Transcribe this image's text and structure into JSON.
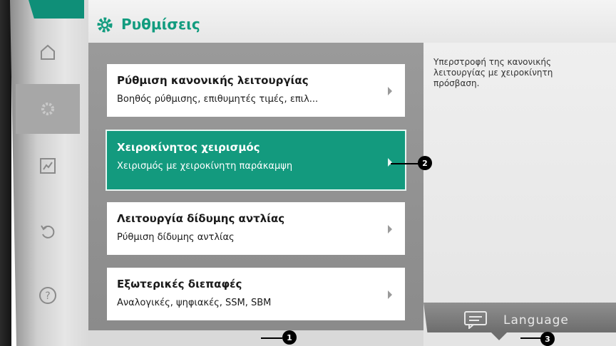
{
  "header": {
    "title": "Ρυθμίσεις",
    "icon": "gear-icon"
  },
  "sidebar": {
    "items": [
      {
        "icon": "home-icon",
        "active": false
      },
      {
        "icon": "settings-icon",
        "active": true
      },
      {
        "icon": "diagnostics-icon",
        "active": false
      },
      {
        "icon": "restore-icon",
        "active": false
      },
      {
        "icon": "help-icon",
        "active": false
      }
    ]
  },
  "menu": {
    "items": [
      {
        "title": "Ρύθμιση κανονικής λειτουργίας",
        "subtitle": "Βοηθός ρύθμισης, επιθυμητές τιμές, επιλ..."
      },
      {
        "title": "Χειροκίνητος χειρισμός",
        "subtitle": "Χειρισμός με χειροκίνητη παράκαμψη",
        "selected": true
      },
      {
        "title": "Λειτουργία δίδυμης αντλίας",
        "subtitle": "Ρύθμιση δίδυμης αντλίας"
      },
      {
        "title": "Εξωτερικές διεπαφές",
        "subtitle": "Αναλογικές, ψηφιακές, SSM, SBM"
      }
    ]
  },
  "help": {
    "text": "Υπερστροφή της κανονικής λειτουργίας με χειροκίνητη πρόσβαση."
  },
  "language_button": {
    "label": "Language",
    "icon": "chat-icon"
  },
  "callouts": {
    "c1": "1",
    "c2": "2",
    "c3": "3"
  },
  "colors": {
    "accent": "#139a7e",
    "header_text": "#129c7f"
  }
}
